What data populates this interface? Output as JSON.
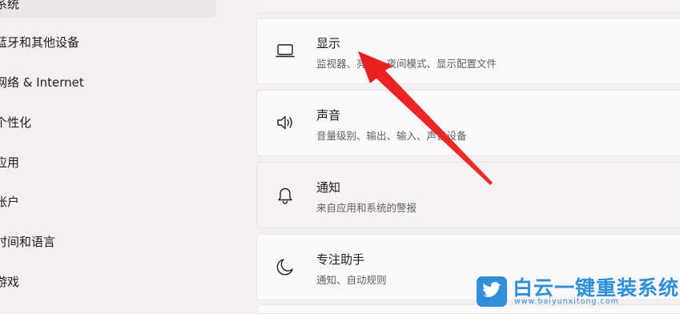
{
  "sidebar": {
    "items": [
      {
        "label": "系统",
        "selected": true
      },
      {
        "label": "蓝牙和其他设备"
      },
      {
        "label": "网络 & Internet"
      },
      {
        "label": "个性化"
      },
      {
        "label": "应用"
      },
      {
        "label": "帐户"
      },
      {
        "label": "时间和语言"
      },
      {
        "label": "游戏"
      }
    ]
  },
  "main": {
    "cards": [
      {
        "icon": "display-monitor-icon",
        "title": "显示",
        "desc": "监视器、亮度、夜间模式、显示配置文件"
      },
      {
        "icon": "speaker-sound-icon",
        "title": "声音",
        "desc": "音量级别、输出、输入、声音设备"
      },
      {
        "icon": "notification-bell-icon",
        "title": "通知",
        "desc": "来自应用和系统的警报"
      },
      {
        "icon": "focus-moon-icon",
        "title": "专注助手",
        "desc": "通知、自动规则"
      }
    ]
  },
  "annotation": {
    "arrow_color": "#e8201f",
    "points_to": "显示"
  },
  "watermark": {
    "name": "白云一键重装系统",
    "url": "www.baiyunxitong.com",
    "color": "#2f8fd9"
  }
}
